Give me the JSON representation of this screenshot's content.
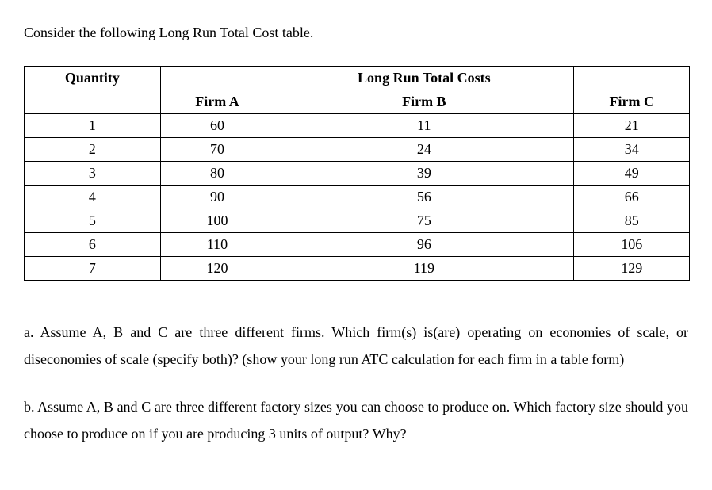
{
  "intro_text": "Consider the following Long Run Total Cost table.",
  "table": {
    "col1_header": "Quantity",
    "merged_header": "Long Run Total Costs",
    "firmA_header": "Firm A",
    "firmB_header": "Firm B",
    "firmC_header": "Firm C",
    "rows": [
      {
        "q": "1",
        "a": "60",
        "b": "11",
        "c": "21"
      },
      {
        "q": "2",
        "a": "70",
        "b": "24",
        "c": "34"
      },
      {
        "q": "3",
        "a": "80",
        "b": "39",
        "c": "49"
      },
      {
        "q": "4",
        "a": "90",
        "b": "56",
        "c": "66"
      },
      {
        "q": "5",
        "a": "100",
        "b": "75",
        "c": "85"
      },
      {
        "q": "6",
        "a": "110",
        "b": "96",
        "c": "106"
      },
      {
        "q": "7",
        "a": "120",
        "b": "119",
        "c": "129"
      }
    ]
  },
  "question_a": "a. Assume A, B and C are three different firms. Which firm(s) is(are) operating on economies of scale, or diseconomies of scale (specify both)? (show your long run ATC calculation for each firm in a table form)",
  "question_b": "b. Assume A, B and C are three different factory sizes you can choose to produce on. Which factory size should you choose to produce on if you are producing 3 units of output? Why?",
  "chart_data": {
    "type": "table",
    "title": "Long Run Total Costs",
    "categories": [
      1,
      2,
      3,
      4,
      5,
      6,
      7
    ],
    "series": [
      {
        "name": "Firm A",
        "values": [
          60,
          70,
          80,
          90,
          100,
          110,
          120
        ]
      },
      {
        "name": "Firm B",
        "values": [
          11,
          24,
          39,
          56,
          75,
          96,
          119
        ]
      },
      {
        "name": "Firm C",
        "values": [
          21,
          34,
          49,
          66,
          85,
          106,
          129
        ]
      }
    ],
    "xlabel": "Quantity",
    "ylabel": "Long Run Total Costs"
  }
}
